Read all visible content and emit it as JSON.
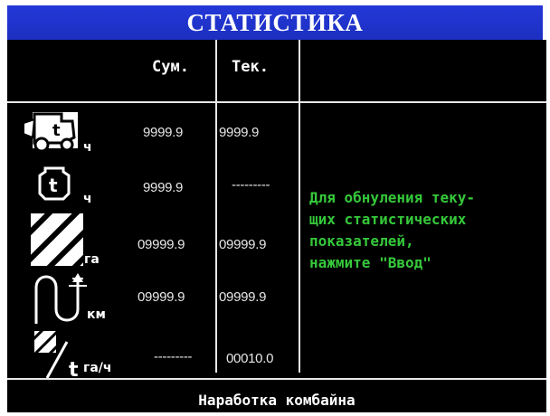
{
  "title": "СТАТИСТИКА",
  "columns": {
    "sum": "Сум.",
    "cur": "Тек."
  },
  "rows": [
    {
      "icon": "combine-hours-icon",
      "unit": "ч",
      "sum": "9999.9",
      "cur": "9999.9"
    },
    {
      "icon": "engine-hours-icon",
      "unit": "ч",
      "sum": "9999.9",
      "cur": "---------"
    },
    {
      "icon": "area-hatch-icon",
      "unit": "га",
      "sum": "09999.9",
      "cur": "09999.9"
    },
    {
      "icon": "distance-road-icon",
      "unit": "км",
      "sum": "09999.9",
      "cur": "09999.9"
    },
    {
      "icon": "productivity-area-per-hour-icon",
      "unit": "га/ч",
      "sum": "---------",
      "cur": "00010.0"
    }
  ],
  "message": "Для обнуления теку-\nщих статистических\nпоказателей,\nнажмите \"Ввод\"",
  "footer": "Наработка комбайна",
  "colors": {
    "title_bg": "#1f33cc",
    "panel_bg": "#000000",
    "message": "#35c83a",
    "text": "#e6e6e6"
  }
}
